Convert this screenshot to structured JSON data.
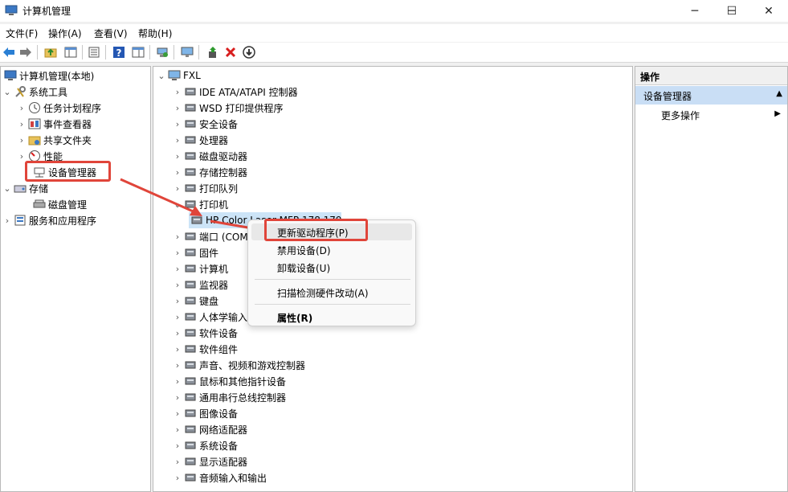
{
  "window": {
    "title": "计算机管理",
    "minimize": "─",
    "maximize": "☐",
    "close": "✕"
  },
  "menu": [
    "文件(F)",
    "操作(A)",
    "查看(V)",
    "帮助(H)"
  ],
  "left_tree": {
    "root": "计算机管理(本地)",
    "system_tools": "系统工具",
    "task_scheduler": "任务计划程序",
    "event_viewer": "事件查看器",
    "shared_folders": "共享文件夹",
    "performance": "性能",
    "device_manager": "设备管理器",
    "storage": "存储",
    "disk_management": "磁盘管理",
    "services_apps": "服务和应用程序"
  },
  "device_tree": {
    "root": "FXL",
    "categories": [
      "IDE ATA/ATAPI 控制器",
      "WSD 打印提供程序",
      "安全设备",
      "处理器",
      "磁盘驱动器",
      "存储控制器",
      "打印队列",
      "打印机",
      "HP Color Laser MFP 178 179",
      "端口 (COM 和 LPT)",
      "固件",
      "计算机",
      "监视器",
      "键盘",
      "人体学输入设备",
      "软件设备",
      "软件组件",
      "声音、视频和游戏控制器",
      "鼠标和其他指针设备",
      "通用串行总线控制器",
      "图像设备",
      "网络适配器",
      "系统设备",
      "显示适配器",
      "音频输入和输出"
    ]
  },
  "context_menu": {
    "update_driver": "更新驱动程序(P)",
    "disable_device": "禁用设备(D)",
    "uninstall_device": "卸载设备(U)",
    "scan_hardware": "扫描检测硬件改动(A)",
    "properties": "属性(R)"
  },
  "actions_pane": {
    "header": "操作",
    "section": "设备管理器",
    "more_actions": "更多操作"
  },
  "colors": {
    "highlight": "#e0453a",
    "selection": "#c9def5",
    "accent": "#0067c0"
  }
}
